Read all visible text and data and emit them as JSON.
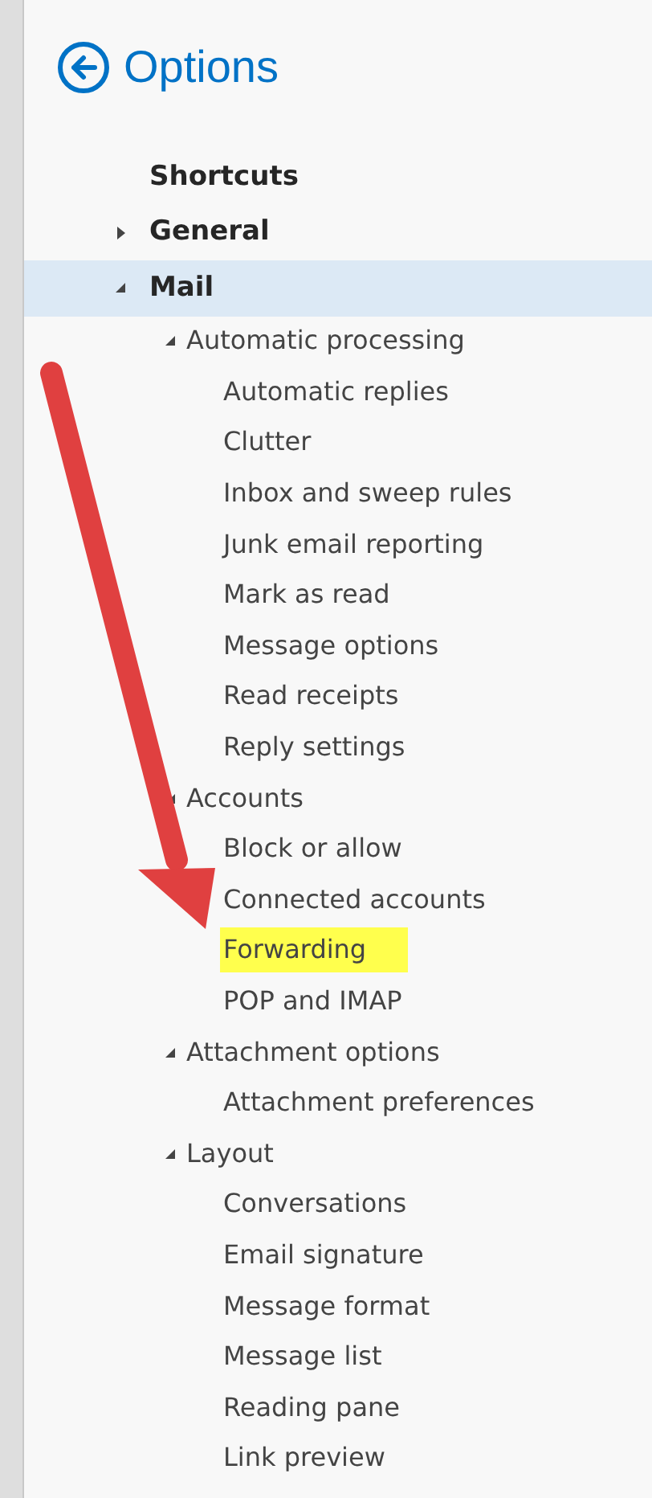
{
  "header": {
    "title": "Options"
  },
  "tree": [
    {
      "label": "Shortcuts",
      "selected": false,
      "highlighted": false
    },
    {
      "label": "General",
      "selected": false,
      "highlighted": false,
      "expanded": false
    },
    {
      "label": "Mail",
      "selected": true,
      "highlighted": false,
      "expanded": true,
      "children": [
        {
          "label": "Automatic processing",
          "selected": false,
          "highlighted": false,
          "expanded": true,
          "children": [
            {
              "label": "Automatic replies",
              "selected": false,
              "highlighted": false
            },
            {
              "label": "Clutter",
              "selected": false,
              "highlighted": false
            },
            {
              "label": "Inbox and sweep rules",
              "selected": false,
              "highlighted": false
            },
            {
              "label": "Junk email reporting",
              "selected": false,
              "highlighted": false
            },
            {
              "label": "Mark as read",
              "selected": false,
              "highlighted": false
            },
            {
              "label": "Message options",
              "selected": false,
              "highlighted": false
            },
            {
              "label": "Read receipts",
              "selected": false,
              "highlighted": false
            },
            {
              "label": "Reply settings",
              "selected": false,
              "highlighted": false
            }
          ]
        },
        {
          "label": "Accounts",
          "selected": false,
          "highlighted": false,
          "expanded": true,
          "children": [
            {
              "label": "Block or allow",
              "selected": false,
              "highlighted": false
            },
            {
              "label": "Connected accounts",
              "selected": false,
              "highlighted": false
            },
            {
              "label": "Forwarding",
              "selected": false,
              "highlighted": true
            },
            {
              "label": "POP and IMAP",
              "selected": false,
              "highlighted": false
            }
          ]
        },
        {
          "label": "Attachment options",
          "selected": false,
          "highlighted": false,
          "expanded": true,
          "children": [
            {
              "label": "Attachment preferences",
              "selected": false,
              "highlighted": false
            }
          ]
        },
        {
          "label": "Layout",
          "selected": false,
          "highlighted": false,
          "expanded": true,
          "children": [
            {
              "label": "Conversations",
              "selected": false,
              "highlighted": false
            },
            {
              "label": "Email signature",
              "selected": false,
              "highlighted": false
            },
            {
              "label": "Message format",
              "selected": false,
              "highlighted": false
            },
            {
              "label": "Message list",
              "selected": false,
              "highlighted": false
            },
            {
              "label": "Reading pane",
              "selected": false,
              "highlighted": false
            },
            {
              "label": "Link preview",
              "selected": false,
              "highlighted": false
            }
          ]
        }
      ]
    }
  ]
}
